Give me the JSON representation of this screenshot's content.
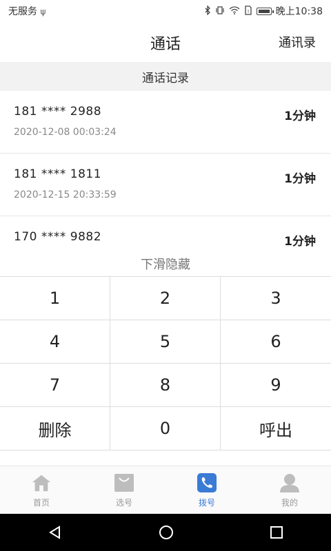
{
  "status": {
    "carrier": "无服务",
    "usb_glyph": "ψ",
    "time": "晚上10:38",
    "icons": [
      "bluetooth-icon",
      "vibrate-icon",
      "wifi-icon",
      "sim-icon",
      "battery-icon"
    ]
  },
  "header": {
    "title": "通话",
    "contacts_label": "通讯录"
  },
  "section": {
    "title": "通话记录"
  },
  "calls": [
    {
      "number": "181 **** 2988",
      "time": "2020-12-08 00:03:24",
      "duration": "1分钟"
    },
    {
      "number": "181 **** 1811",
      "time": "2020-12-15 20:33:59",
      "duration": "1分钟"
    },
    {
      "number": "170 **** 9882",
      "time": "",
      "duration": "1分钟"
    }
  ],
  "hint": "下滑隐藏",
  "keypad": [
    "1",
    "2",
    "3",
    "4",
    "5",
    "6",
    "7",
    "8",
    "9",
    "删除",
    "0",
    "呼出"
  ],
  "tabs": [
    {
      "label": "首页",
      "icon": "home-icon",
      "active": false
    },
    {
      "label": "选号",
      "icon": "bag-icon",
      "active": false
    },
    {
      "label": "拨号",
      "icon": "phone-icon",
      "active": true
    },
    {
      "label": "我的",
      "icon": "user-icon",
      "active": false
    }
  ],
  "colors": {
    "accent": "#3a7bd5",
    "tab_inactive": "#bdbdbd"
  }
}
